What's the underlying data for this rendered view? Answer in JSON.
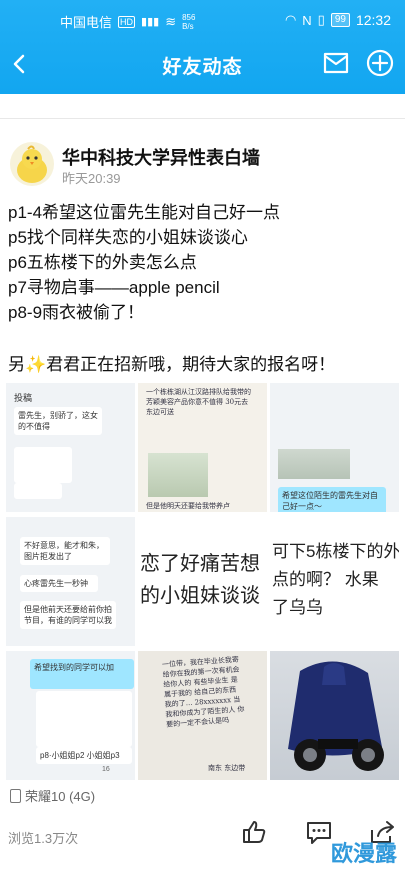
{
  "status_bar": {
    "carrier": "中国电信",
    "hd": "HD",
    "signal": "⁴⁶",
    "speed": "856\nB/s",
    "battery": "99",
    "time": "12:32"
  },
  "header": {
    "title": "好友动态"
  },
  "post": {
    "author": "华中科技大学异性表白墙",
    "time": "昨天20:39",
    "lines": [
      "p1-4希望这位雷先生能对自己好一点",
      "p5找个同样失恋的小姐妹谈谈心",
      "p6五栋楼下的外卖怎么点",
      "p7寻物启事——apple pencil",
      "p8-9雨衣被偷了！"
    ],
    "note": "另✨君君正在招新哦，期待大家的报名呀！",
    "images": {
      "t1": {
        "title": "投稿",
        "line1": "雷先生，别骄了，这女的不值得"
      },
      "t2": {
        "text": "一个栋栋湖从江汉路排队给我带的 芳颖美容产品你意不值得 30元去 东边可送",
        "caption": "但是他明天还要给我带养卢"
      },
      "t3": {
        "text": "希望这位陌生的雷先生对自己好一点～"
      },
      "t4": {
        "b1": "不好意思，能才和朱，图片拒发出了",
        "b2": "心疼雷先生一秒钟",
        "b3": "但是他前天还要给前你拍节目，有谁的同学可以我"
      },
      "t5": {
        "l1": "恋了好痛苦想",
        "l2": "的小姐妹谈谈"
      },
      "t6": {
        "l1": "可下5栋楼下的外",
        "l2": "点的啊？ 水果",
        "l3": "了乌乌"
      },
      "t7": {
        "b1": "希望找到的同学可以加",
        "b2": "p8·小姐姐p2 小姐姐p3",
        "likes": "16"
      },
      "t8": {
        "text": "一位带，我在毕业长我寄给你在我的第一次有机会 给你人的 有些毕业生 是属于我的 给自己的东西 我的了... 28xxxxxxx 当我和你成为了陌生的人 你要的一定不会认是吗",
        "caption": "南东 东边带"
      },
      "t9": {}
    },
    "device": "荣耀10 (4G)",
    "views": "浏览1.3万次"
  },
  "watermark": "欧漫露",
  "colors": {
    "header_blue": "#1aabf2",
    "watermark_blue": "#1a8fd8"
  }
}
